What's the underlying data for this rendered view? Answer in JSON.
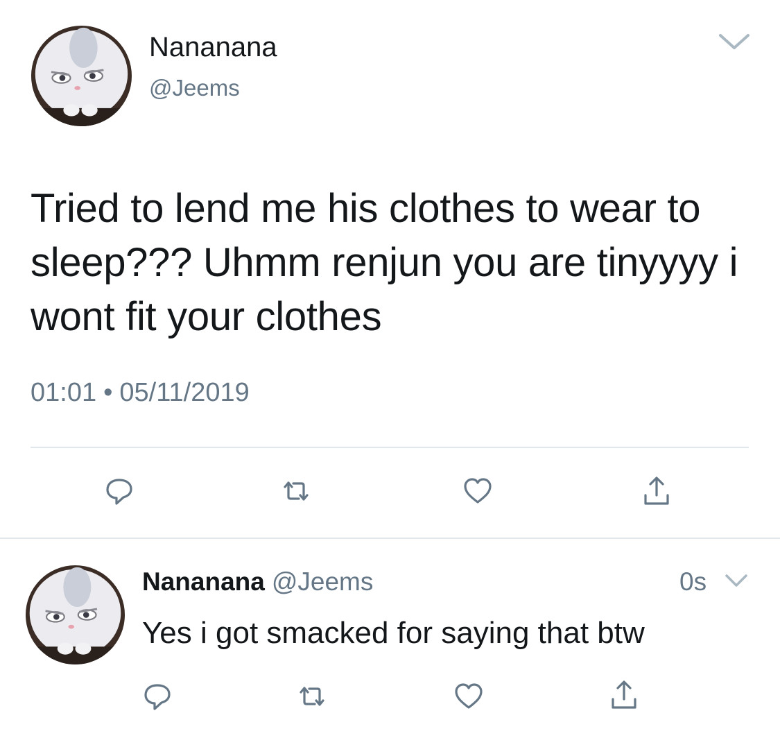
{
  "main_tweet": {
    "display_name": "Nananana",
    "handle": "@Jeems",
    "text": "Tried to lend me his clothes to wear to sleep??? Uhmm renjun you are tinyyyy i wont fit your clothes",
    "time": "01:01",
    "separator": "•",
    "date": "05/11/2019",
    "avatar_icon": "white-rabbit-avatar",
    "actions": [
      "reply-icon",
      "retweet-icon",
      "like-icon",
      "share-icon"
    ]
  },
  "reply_tweet": {
    "display_name": "Nananana",
    "handle": "@Jeems",
    "time_ago": "0s",
    "text": "Yes i got smacked for saying that btw",
    "avatar_icon": "white-rabbit-avatar",
    "actions": [
      "reply-icon",
      "retweet-icon",
      "like-icon",
      "share-icon"
    ]
  },
  "colors": {
    "text_primary": "#14171a",
    "text_secondary": "#657786",
    "icon_gray": "#657786",
    "divider": "#e1e8ed",
    "background": "#ffffff"
  }
}
